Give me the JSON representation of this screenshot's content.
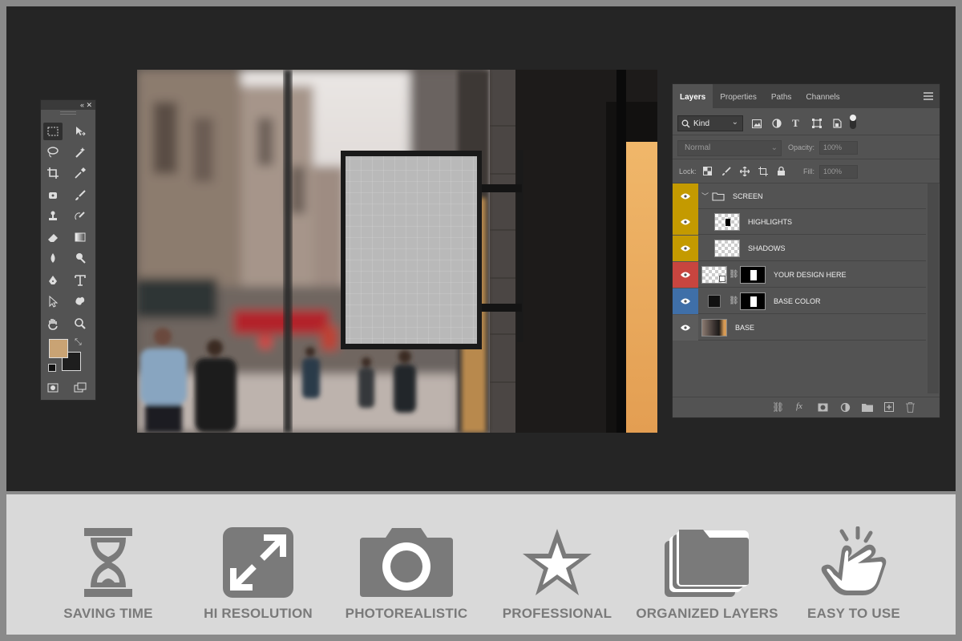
{
  "layers_panel": {
    "tabs": [
      "Layers",
      "Properties",
      "Paths",
      "Channels"
    ],
    "filter_kind": "Kind",
    "blend_mode": "Normal",
    "opacity_label": "Opacity:",
    "opacity_value": "100%",
    "lock_label": "Lock:",
    "fill_label": "Fill:",
    "fill_value": "100%",
    "layers": [
      {
        "name": "SCREEN",
        "type": "group",
        "eye_color": "#c49a00"
      },
      {
        "name": "HIGHLIGHTS",
        "type": "layer",
        "eye_color": "#c49a00"
      },
      {
        "name": "SHADOWS",
        "type": "layer",
        "eye_color": "#c49a00"
      },
      {
        "name": "YOUR DESIGN HERE",
        "type": "smart-object",
        "eye_color": "#c8453f"
      },
      {
        "name": "BASE COLOR",
        "type": "fill",
        "eye_color": "#3f6fa8"
      },
      {
        "name": "BASE",
        "type": "image",
        "eye_color": "#5c5c5c"
      }
    ]
  },
  "toolbar": {
    "foreground_color": "#c9a374",
    "background_color": "#1e1e1e"
  },
  "features": [
    {
      "label": "SAVING TIME",
      "icon": "hourglass-icon"
    },
    {
      "label": "HI RESOLUTION",
      "icon": "expand-icon"
    },
    {
      "label": "PHOTOREALISTIC",
      "icon": "camera-icon"
    },
    {
      "label": "PROFESSIONAL",
      "icon": "star-icon"
    },
    {
      "label": "ORGANIZED LAYERS",
      "icon": "folder-stack-icon"
    },
    {
      "label": "EASY TO USE",
      "icon": "tap-hand-icon"
    }
  ]
}
